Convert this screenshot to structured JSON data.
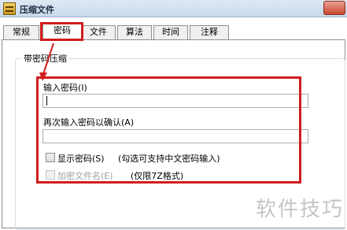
{
  "window": {
    "title": "压缩文件"
  },
  "tabs": [
    {
      "label": "常规"
    },
    {
      "label": "密码"
    },
    {
      "label": "文件"
    },
    {
      "label": "算法"
    },
    {
      "label": "时间"
    },
    {
      "label": "注释"
    }
  ],
  "active_tab": "密码",
  "group": {
    "title": "带密码压缩"
  },
  "password": {
    "label": "输入密码(I)",
    "value": ""
  },
  "confirm": {
    "label": "再次输入密码以确认(A)",
    "value": ""
  },
  "show_password": {
    "label": "显示密码(S)",
    "hint": "(勾选可支持中文密码输入)",
    "checked": false
  },
  "encrypt_names": {
    "label": "加密文件名(E)",
    "hint": "(仅限7Z格式)",
    "checked": false,
    "enabled": false
  },
  "watermark": {
    "text": "软件技巧"
  },
  "colors": {
    "highlight": "#d21c1c",
    "titlebar": "#c9d8ea"
  }
}
